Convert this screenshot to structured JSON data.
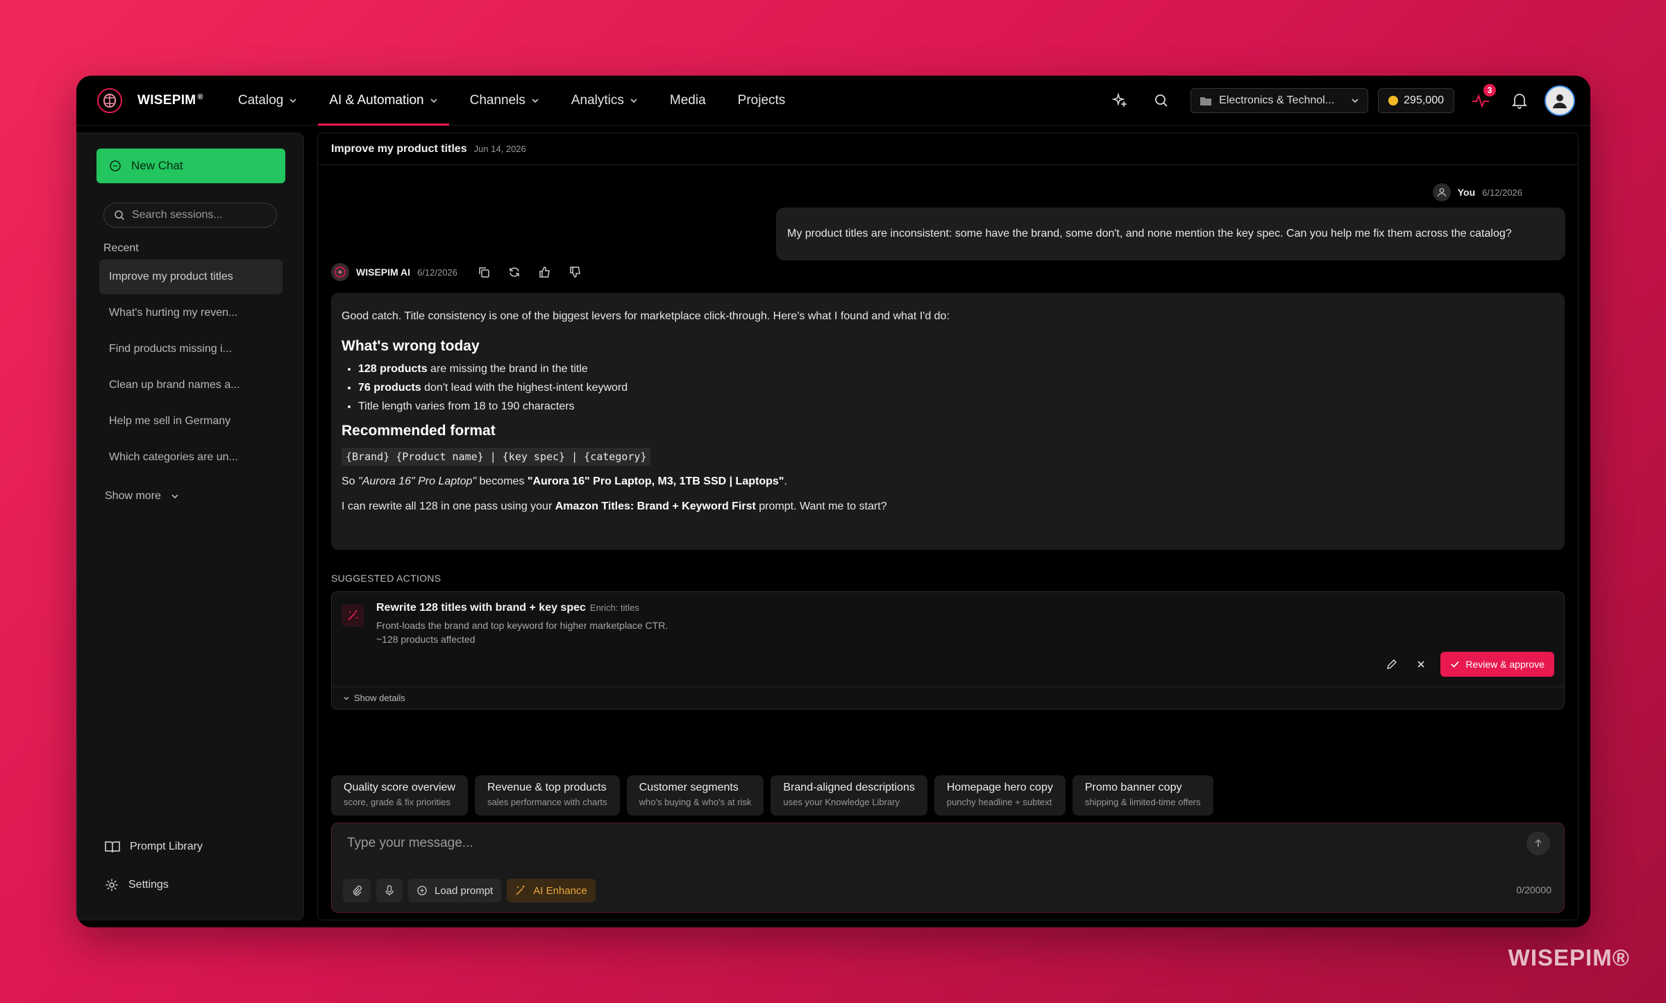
{
  "brand": {
    "name": "WISEPIM",
    "reg": "®",
    "watermark": "WISEPIM®"
  },
  "nav": {
    "items": [
      {
        "label": "Catalog",
        "dropdown": true
      },
      {
        "label": "AI & Automation",
        "dropdown": true,
        "active": true
      },
      {
        "label": "Channels",
        "dropdown": true
      },
      {
        "label": "Analytics",
        "dropdown": true
      },
      {
        "label": "Media",
        "dropdown": false
      },
      {
        "label": "Projects",
        "dropdown": false
      }
    ],
    "store": "Electronics & Technol...",
    "credits": "295,000",
    "alerts_count": "3"
  },
  "sidebar": {
    "new_chat": "New Chat",
    "search_placeholder": "Search sessions...",
    "recent_label": "Recent",
    "sessions": [
      "Improve my product titles",
      "What's hurting my reven...",
      "Find products missing i...",
      "Clean up brand names a...",
      "Help me sell in Germany",
      "Which categories are un..."
    ],
    "show_more": "Show more",
    "prompt_library": "Prompt Library",
    "settings": "Settings"
  },
  "chat": {
    "title": "Improve my product titles",
    "date": "Jun 14, 2026",
    "user": {
      "name": "You",
      "date": "6/12/2026",
      "message": "My product titles are inconsistent: some have the brand, some don't, and none mention the key spec. Can you help me fix them across the catalog?"
    },
    "ai": {
      "name": "WISEPIM AI",
      "date": "6/12/2026",
      "intro": "Good catch. Title consistency is one of the biggest levers for marketplace click-through. Here's what I found and what I'd do:",
      "h1": "What's wrong today",
      "bullets": [
        {
          "bold": "128 products",
          "rest": " are missing the brand in the title"
        },
        {
          "bold": "76 products",
          "rest": " don't lead with the highest-intent keyword"
        },
        {
          "bold": "",
          "rest": "Title length varies from 18 to 190 characters"
        }
      ],
      "h2": "Recommended format",
      "code": "{Brand} {Product name} | {key spec} | {category}",
      "example_pre": "So ",
      "example_from": "\"Aurora 16\" Pro Laptop\"",
      "example_mid": " becomes ",
      "example_to": "\"Aurora 16\" Pro Laptop, M3, 1TB SSD | Laptops\"",
      "example_end": ".",
      "closing_pre": "I can rewrite all 128 in one pass using your ",
      "closing_bold": "Amazon Titles: Brand + Keyword First",
      "closing_post": " prompt. Want me to start?"
    },
    "suggested_label": "SUGGESTED ACTIONS",
    "suggestion": {
      "title": "Rewrite 128 titles with brand + key spec",
      "tag": "Enrich: titles",
      "desc": "Front-loads the brand and top keyword for higher marketplace CTR.",
      "affected": "~128 products affected",
      "approve": "Review & approve",
      "details": "Show details"
    },
    "chips": [
      {
        "title": "Quality score overview",
        "sub": "score, grade & fix priorities"
      },
      {
        "title": "Revenue & top products",
        "sub": "sales performance with charts"
      },
      {
        "title": "Customer segments",
        "sub": "who's buying & who's at risk"
      },
      {
        "title": "Brand-aligned descriptions",
        "sub": "uses your Knowledge Library"
      },
      {
        "title": "Homepage hero copy",
        "sub": "punchy headline + subtext"
      },
      {
        "title": "Promo banner copy",
        "sub": "shipping & limited-time offers"
      }
    ],
    "composer": {
      "placeholder": "Type your message...",
      "load_prompt": "Load prompt",
      "ai_enhance": "AI Enhance",
      "counter": "0/20000"
    }
  },
  "colors": {
    "accent": "#e8194f",
    "new_chat": "#22c55e",
    "enhance": "#e9a83a"
  }
}
